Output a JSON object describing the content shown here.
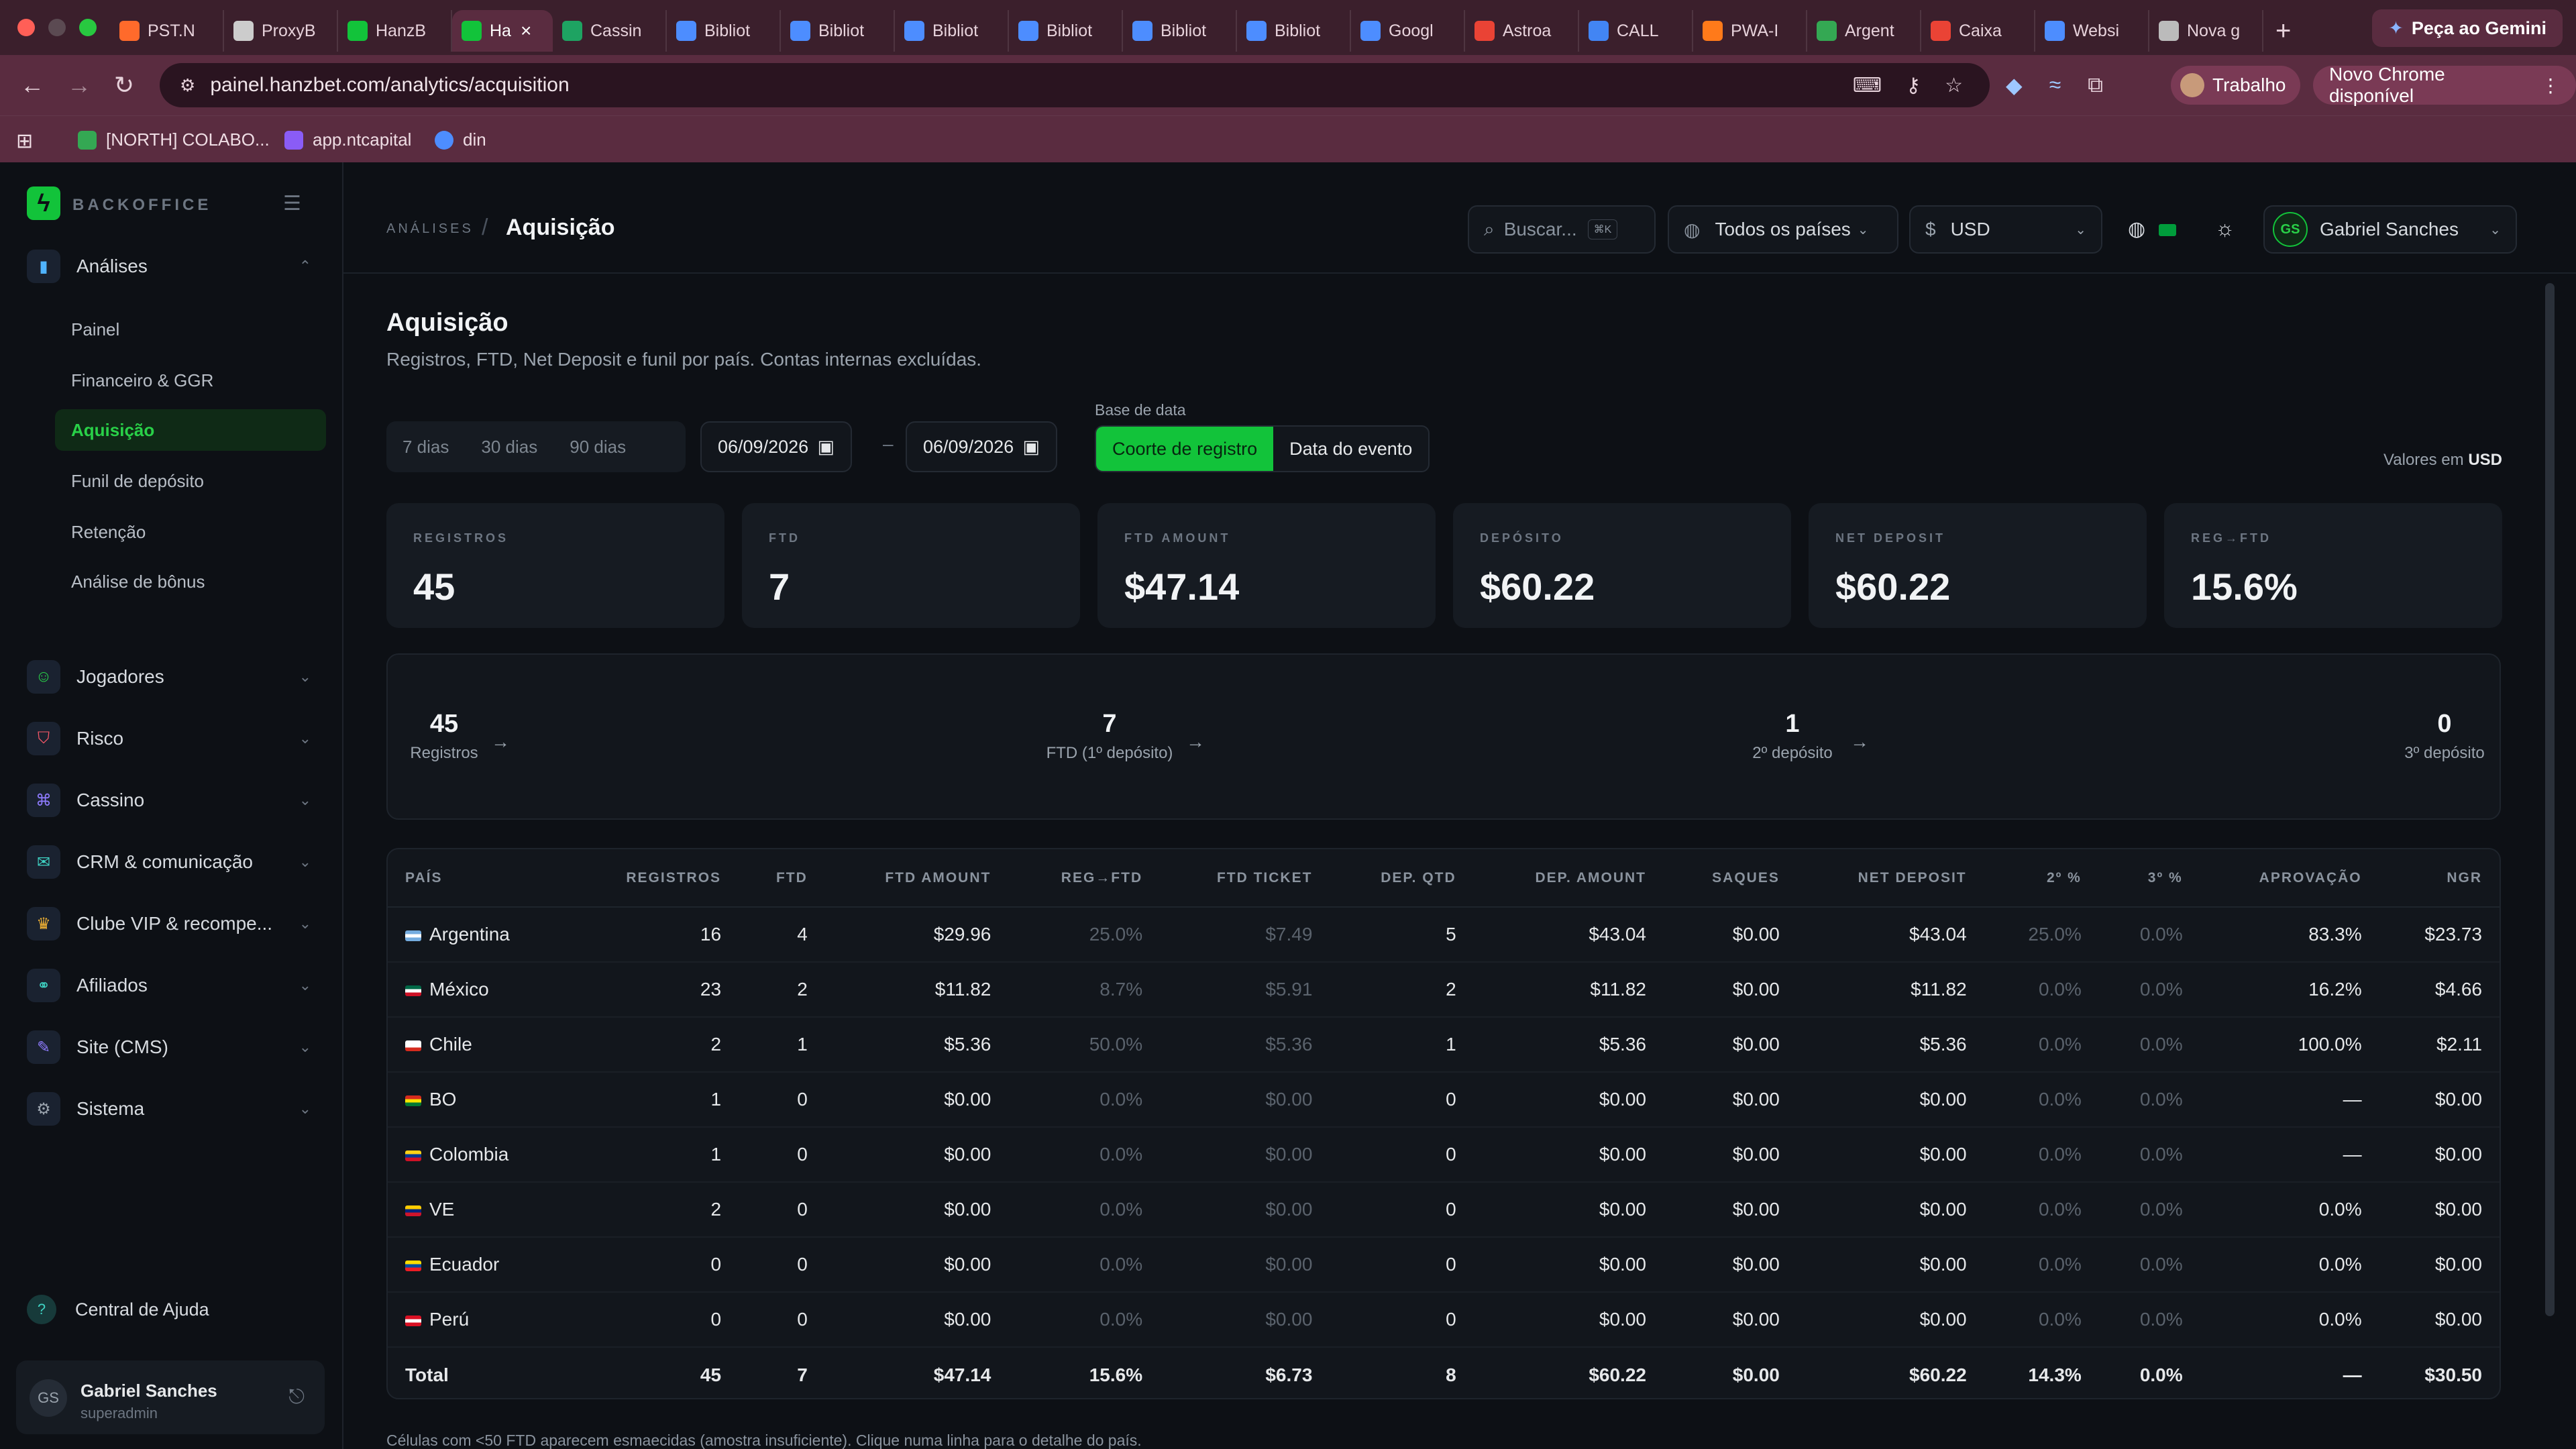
{
  "browser": {
    "tabs": [
      {
        "label": "PST.N",
        "fav_color": "#ff6a2b",
        "active": false
      },
      {
        "label": "ProxyB",
        "fav_color": "#cccccc",
        "active": false
      },
      {
        "label": "HanzB",
        "fav_color": "#12c33a",
        "active": false
      },
      {
        "label": "Ha",
        "fav_color": "#12c33a",
        "active": true
      },
      {
        "label": "Cassin",
        "fav_color": "#1ea362",
        "active": false
      },
      {
        "label": "Bibliot",
        "fav_color": "#4d8dff",
        "active": false
      },
      {
        "label": "Bibliot",
        "fav_color": "#4d8dff",
        "active": false
      },
      {
        "label": "Bibliot",
        "fav_color": "#4d8dff",
        "active": false
      },
      {
        "label": "Bibliot",
        "fav_color": "#4d8dff",
        "active": false
      },
      {
        "label": "Bibliot",
        "fav_color": "#4d8dff",
        "active": false
      },
      {
        "label": "Bibliot",
        "fav_color": "#4d8dff",
        "active": false
      },
      {
        "label": "Googl",
        "fav_color": "#4d8dff",
        "active": false
      },
      {
        "label": "Astroa",
        "fav_color": "#ea4335",
        "active": false
      },
      {
        "label": "CALL",
        "fav_color": "#4285f4",
        "active": false
      },
      {
        "label": "PWA-I",
        "fav_color": "#ff7a1a",
        "active": false
      },
      {
        "label": "Argent",
        "fav_color": "#34a853",
        "active": false
      },
      {
        "label": "Caixa",
        "fav_color": "#ea4335",
        "active": false
      },
      {
        "label": "Websi",
        "fav_color": "#4d8dff",
        "active": false
      },
      {
        "label": "Nova g",
        "fav_color": "#bbbbbb",
        "active": false
      }
    ],
    "gemini_label": "Peça ao Gemini",
    "url": "painel.hanzbet.com/analytics/acquisition",
    "profile_label": "Trabalho",
    "update_label": "Novo Chrome disponível",
    "bookmarks": [
      {
        "label": "[NORTH] COLABO...",
        "color": "#34a853"
      },
      {
        "label": "app.ntcapital",
        "color": "#8a5cf6"
      },
      {
        "label": "din",
        "color": "#4d8dff"
      }
    ]
  },
  "sidebar": {
    "brand": "BACKOFFICE",
    "groups": [
      {
        "label": "Análises",
        "icon": "bar-chart-icon",
        "glyph": "▮",
        "color": "#4fb3ff",
        "expanded": true
      },
      {
        "label": "Jogadores",
        "icon": "users-icon",
        "glyph": "☺",
        "color": "#29d148"
      },
      {
        "label": "Risco",
        "icon": "shield-icon",
        "glyph": "⛉",
        "color": "#ff5a6a"
      },
      {
        "label": "Cassino",
        "icon": "gamepad-icon",
        "glyph": "⌘",
        "color": "#8f7cff"
      },
      {
        "label": "CRM & comunicação",
        "icon": "message-icon",
        "glyph": "✉",
        "color": "#3fd3c4"
      },
      {
        "label": "Clube VIP & recompe...",
        "icon": "trophy-icon",
        "glyph": "♛",
        "color": "#f2b233"
      },
      {
        "label": "Afiliados",
        "icon": "network-icon",
        "glyph": "⚭",
        "color": "#3fd3c4"
      },
      {
        "label": "Site (CMS)",
        "icon": "edit-icon",
        "glyph": "✎",
        "color": "#8f7cff"
      },
      {
        "label": "Sistema",
        "icon": "gear-icon",
        "glyph": "⚙",
        "color": "#9aa3ad"
      }
    ],
    "sub_items": [
      "Painel",
      "Financeiro & GGR",
      "Aquisição",
      "Funil de depósito",
      "Retenção",
      "Análise de bônus"
    ],
    "active_sub": "Aquisição",
    "help_label": "Central de Ajuda",
    "user": {
      "initials": "GS",
      "name": "Gabriel Sanches",
      "role": "superadmin"
    }
  },
  "topbar": {
    "crumb_parent": "ANÁLISES",
    "crumb_sep": "/",
    "crumb_current": "Aquisição",
    "search_placeholder": "Buscar...",
    "search_kbd": "⌘K",
    "country_filter": "Todos os países",
    "currency_symbol": "$",
    "currency": "USD",
    "user_initials": "GS",
    "user_name": "Gabriel Sanches"
  },
  "page": {
    "title": "Aquisição",
    "subtitle": "Registros, FTD, Net Deposit e funil por país. Contas internas excluídas.",
    "ranges": [
      "7 dias",
      "30 dias",
      "90 dias"
    ],
    "date_from": "06/09/2026",
    "date_to": "06/09/2026",
    "date_dash": "–",
    "date_base_label": "Base de data",
    "date_base_options": [
      "Coorte de registro",
      "Data do evento"
    ],
    "date_base_selected": "Coorte de registro",
    "values_note_prefix": "Valores em",
    "values_note_currency": "USD",
    "footnote": "Células com <50 FTD aparecem esmaecidas (amostra insuficiente). Clique numa linha para o detalhe do país."
  },
  "kpis": [
    {
      "label": "REGISTROS",
      "value": "45"
    },
    {
      "label": "FTD",
      "value": "7"
    },
    {
      "label": "FTD AMOUNT",
      "value": "$47.14"
    },
    {
      "label": "DEPÓSITO",
      "value": "$60.22"
    },
    {
      "label": "NET DEPOSIT",
      "value": "$60.22"
    },
    {
      "label": "REG→FTD",
      "value": "15.6%"
    }
  ],
  "funnel": [
    {
      "value": "45",
      "label": "Registros"
    },
    {
      "value": "7",
      "label": "FTD (1º depósito)"
    },
    {
      "value": "1",
      "label": "2º depósito"
    },
    {
      "value": "0",
      "label": "3º depósito"
    }
  ],
  "table": {
    "columns": [
      "PAÍS",
      "REGISTROS",
      "FTD",
      "FTD AMOUNT",
      "REG→FTD",
      "FTD TICKET",
      "DEP. QTD",
      "DEP. AMOUNT",
      "SAQUES",
      "NET DEPOSIT",
      "2º %",
      "3º %",
      "APROVAÇÃO",
      "NGR"
    ],
    "dim_columns": [
      4,
      5,
      10,
      11
    ],
    "rows": [
      {
        "flag": [
          "#74acdf",
          "#ffffff",
          "#74acdf"
        ],
        "cells": [
          "Argentina",
          "16",
          "4",
          "$29.96",
          "25.0%",
          "$7.49",
          "5",
          "$43.04",
          "$0.00",
          "$43.04",
          "25.0%",
          "0.0%",
          "83.3%",
          "$23.73"
        ]
      },
      {
        "flag": [
          "#006847",
          "#ffffff",
          "#ce1126"
        ],
        "cells": [
          "México",
          "23",
          "2",
          "$11.82",
          "8.7%",
          "$5.91",
          "2",
          "$11.82",
          "$0.00",
          "$11.82",
          "0.0%",
          "0.0%",
          "16.2%",
          "$4.66"
        ]
      },
      {
        "flag": [
          "#ffffff",
          "#ffffff",
          "#d52b1e"
        ],
        "cells": [
          "Chile",
          "2",
          "1",
          "$5.36",
          "50.0%",
          "$5.36",
          "1",
          "$5.36",
          "$0.00",
          "$5.36",
          "0.0%",
          "0.0%",
          "100.0%",
          "$2.11"
        ]
      },
      {
        "flag": [
          "#d52b1e",
          "#f9e300",
          "#007934"
        ],
        "cells": [
          "BO",
          "1",
          "0",
          "$0.00",
          "0.0%",
          "$0.00",
          "0",
          "$0.00",
          "$0.00",
          "$0.00",
          "0.0%",
          "0.0%",
          "—",
          "$0.00"
        ]
      },
      {
        "flag": [
          "#fcd116",
          "#003893",
          "#ce1126"
        ],
        "cells": [
          "Colombia",
          "1",
          "0",
          "$0.00",
          "0.0%",
          "$0.00",
          "0",
          "$0.00",
          "$0.00",
          "$0.00",
          "0.0%",
          "0.0%",
          "—",
          "$0.00"
        ]
      },
      {
        "flag": [
          "#ffcc00",
          "#00247d",
          "#cf142b"
        ],
        "cells": [
          "VE",
          "2",
          "0",
          "$0.00",
          "0.0%",
          "$0.00",
          "0",
          "$0.00",
          "$0.00",
          "$0.00",
          "0.0%",
          "0.0%",
          "0.0%",
          "$0.00"
        ]
      },
      {
        "flag": [
          "#ffdd00",
          "#034ea2",
          "#ed1c24"
        ],
        "cells": [
          "Ecuador",
          "0",
          "0",
          "$0.00",
          "0.0%",
          "$0.00",
          "0",
          "$0.00",
          "$0.00",
          "$0.00",
          "0.0%",
          "0.0%",
          "0.0%",
          "$0.00"
        ]
      },
      {
        "flag": [
          "#d91023",
          "#ffffff",
          "#d91023"
        ],
        "cells": [
          "Perú",
          "0",
          "0",
          "$0.00",
          "0.0%",
          "$0.00",
          "0",
          "$0.00",
          "$0.00",
          "$0.00",
          "0.0%",
          "0.0%",
          "0.0%",
          "$0.00"
        ]
      }
    ],
    "total": [
      "Total",
      "45",
      "7",
      "$47.14",
      "15.6%",
      "$6.73",
      "8",
      "$60.22",
      "$0.00",
      "$60.22",
      "14.3%",
      "0.0%",
      "—",
      "$30.50"
    ]
  }
}
